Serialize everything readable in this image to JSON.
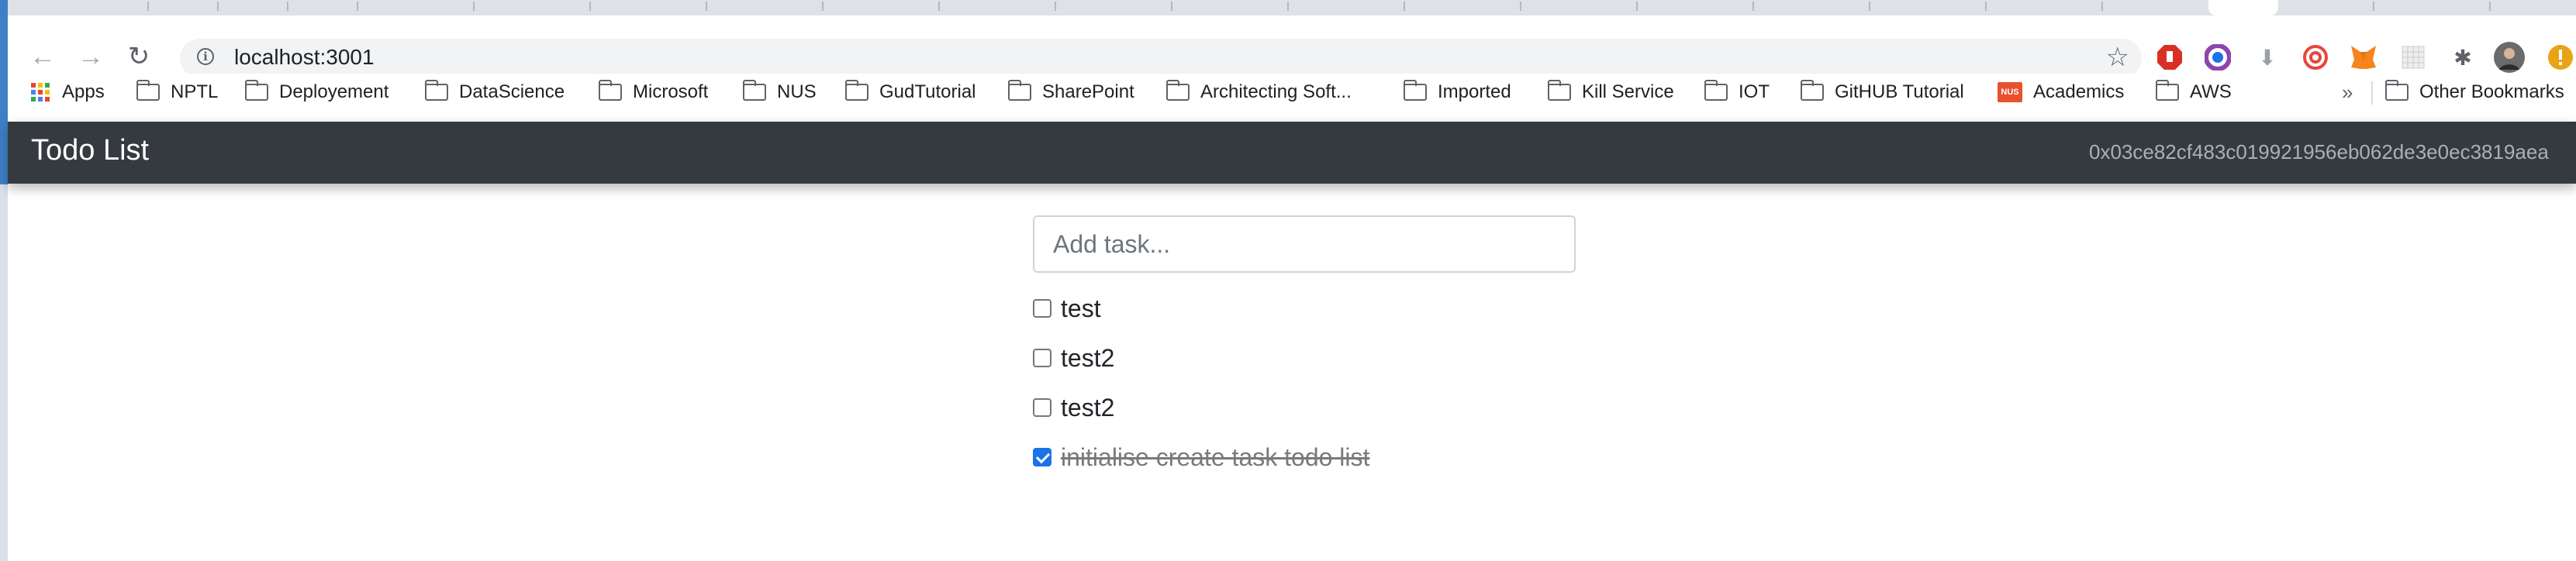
{
  "browser": {
    "url": "localhost:3001",
    "bookmarks": [
      {
        "label": "Apps",
        "icon": "apps-grid-icon"
      },
      {
        "label": "NPTL",
        "icon": "folder-icon"
      },
      {
        "label": "Deployement",
        "icon": "folder-icon"
      },
      {
        "label": "DataScience",
        "icon": "folder-icon"
      },
      {
        "label": "Microsoft",
        "icon": "folder-icon"
      },
      {
        "label": "NUS",
        "icon": "folder-icon"
      },
      {
        "label": "GudTutorial",
        "icon": "folder-icon"
      },
      {
        "label": "SharePoint",
        "icon": "folder-icon"
      },
      {
        "label": "Architecting Soft...",
        "icon": "folder-icon"
      },
      {
        "label": "Imported",
        "icon": "folder-icon"
      },
      {
        "label": "Kill Service",
        "icon": "folder-icon"
      },
      {
        "label": "IOT",
        "icon": "folder-icon"
      },
      {
        "label": "GitHUB Tutorial",
        "icon": "folder-icon"
      },
      {
        "label": "Academics",
        "icon": "nus-logo-icon"
      },
      {
        "label": "AWS",
        "icon": "folder-icon"
      }
    ],
    "overflow_label": "»",
    "other_bookmarks": "Other Bookmarks",
    "nus_badge_text": "NUS"
  },
  "app": {
    "title": "Todo List",
    "account": "0x03ce82cf483c019921956eb062de3e0ec3819aea",
    "input_placeholder": "Add task...",
    "tasks": [
      {
        "label": "test",
        "done": false
      },
      {
        "label": "test2",
        "done": false
      },
      {
        "label": "test2",
        "done": false
      },
      {
        "label": "initialise create task todo list",
        "done": true
      }
    ]
  },
  "colors": {
    "navbar": "#343a40",
    "checkbox_checked": "#1a73e8"
  }
}
